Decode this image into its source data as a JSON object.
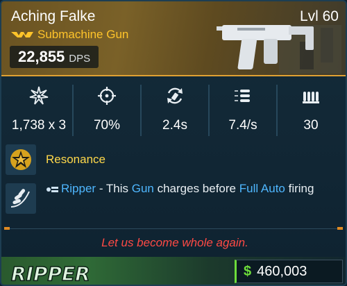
{
  "weapon": {
    "name": "Aching Falke",
    "level": "Lvl 60",
    "type": "Submachine Gun",
    "dps_value": "22,855",
    "dps_label": "DPS",
    "rarity_color": "#ffc42a",
    "header_border_color": "#e0a133",
    "image": "submachine-gun-image"
  },
  "stats": [
    {
      "icon": "damage-burst-icon",
      "value": "1,738 x 3"
    },
    {
      "icon": "crosshair-icon",
      "value": "70%"
    },
    {
      "icon": "reload-icon",
      "value": "2.4s"
    },
    {
      "icon": "fire-rate-icon",
      "value": "7.4/s"
    },
    {
      "icon": "magazine-icon",
      "value": "30"
    }
  ],
  "perks": {
    "resonance": {
      "icon": "resonance-star-icon",
      "label": "Resonance",
      "color": "#ffd84a"
    },
    "ripper": {
      "icon": "ammo-belt-icon",
      "name": "Ripper",
      "sep": " - This ",
      "gun": "Gun",
      "mid": " charges before ",
      "mode": "Full Auto",
      "end": " firing",
      "highlight_color": "#4fb7ff"
    }
  },
  "flavor_text": "Let us become whole again.",
  "flavor_color": "#ff4a45",
  "footer": {
    "manufacturer_logo_text": "RIPPER",
    "currency_symbol": "$",
    "price": "460,003",
    "currency_color": "#6ddc3a"
  }
}
